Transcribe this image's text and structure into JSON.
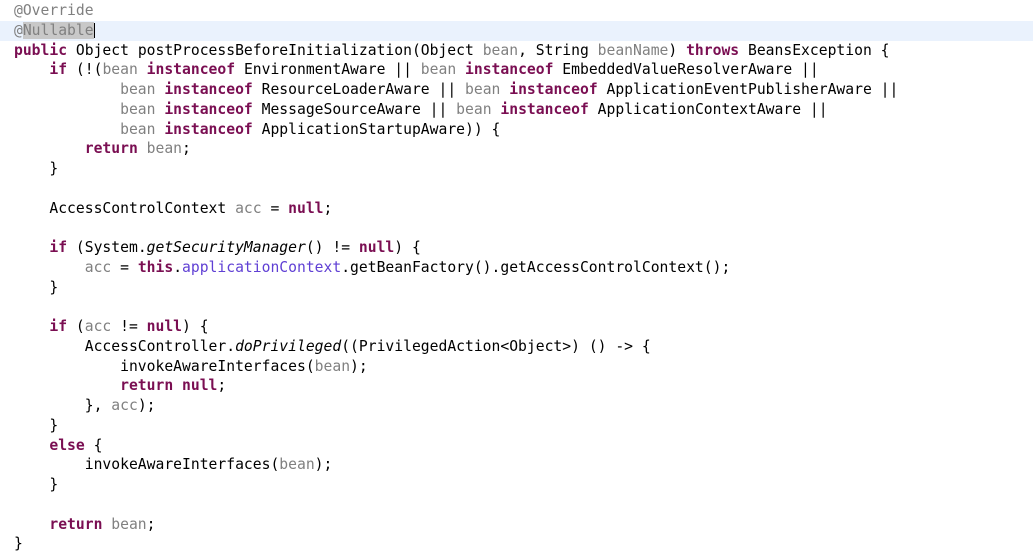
{
  "editor": {
    "language": "java",
    "background_color": "#ffffff",
    "current_line_highlight_color": "#eaf2fd",
    "selection_color": "#c8c8c8",
    "keyword_color": "#7a0e52",
    "annotation_color": "#808080",
    "parameter_color": "#808080",
    "field_color": "#5f3fd4",
    "text_color": "#000000",
    "caret_line_number": 2,
    "selected_text": "Nullable"
  },
  "lines": [
    {
      "n": 1,
      "text": "@Override"
    },
    {
      "n": 2,
      "text": "@Nullable"
    },
    {
      "n": 3,
      "text": "public Object postProcessBeforeInitialization(Object bean, String beanName) throws BeansException {"
    },
    {
      "n": 4,
      "text": "    if (!(bean instanceof EnvironmentAware || bean instanceof EmbeddedValueResolverAware ||"
    },
    {
      "n": 5,
      "text": "            bean instanceof ResourceLoaderAware || bean instanceof ApplicationEventPublisherAware ||"
    },
    {
      "n": 6,
      "text": "            bean instanceof MessageSourceAware || bean instanceof ApplicationContextAware ||"
    },
    {
      "n": 7,
      "text": "            bean instanceof ApplicationStartupAware)) {"
    },
    {
      "n": 8,
      "text": "        return bean;"
    },
    {
      "n": 9,
      "text": "    }"
    },
    {
      "n": 10,
      "text": ""
    },
    {
      "n": 11,
      "text": "    AccessControlContext acc = null;"
    },
    {
      "n": 12,
      "text": ""
    },
    {
      "n": 13,
      "text": "    if (System.getSecurityManager() != null) {"
    },
    {
      "n": 14,
      "text": "        acc = this.applicationContext.getBeanFactory().getAccessControlContext();"
    },
    {
      "n": 15,
      "text": "    }"
    },
    {
      "n": 16,
      "text": ""
    },
    {
      "n": 17,
      "text": "    if (acc != null) {"
    },
    {
      "n": 18,
      "text": "        AccessController.doPrivileged((PrivilegedAction<Object>) () -> {"
    },
    {
      "n": 19,
      "text": "            invokeAwareInterfaces(bean);"
    },
    {
      "n": 20,
      "text": "            return null;"
    },
    {
      "n": 21,
      "text": "        }, acc);"
    },
    {
      "n": 22,
      "text": "    }"
    },
    {
      "n": 23,
      "text": "    else {"
    },
    {
      "n": 24,
      "text": "        invokeAwareInterfaces(bean);"
    },
    {
      "n": 25,
      "text": "    }"
    },
    {
      "n": 26,
      "text": ""
    },
    {
      "n": 27,
      "text": "    return bean;"
    },
    {
      "n": 28,
      "text": "}"
    }
  ],
  "tokens": {
    "l1": {
      "annotation": "@Override"
    },
    "l2": {
      "at": "@",
      "selected": "Nullable"
    },
    "l3": {
      "kw_public": "public",
      "type_object": "Object",
      "method_name": "postProcessBeforeInitialization",
      "p1_type": "Object",
      "p1_name": "bean",
      "p2_type": "String",
      "p2_name": "beanName",
      "kw_throws": "throws",
      "exception": "BeansException"
    },
    "l4": {
      "kw_if": "if",
      "var_bean": "bean",
      "kw_instanceof": "instanceof",
      "type_a": "EnvironmentAware",
      "type_b": "EmbeddedValueResolverAware"
    },
    "l5": {
      "type_a": "ResourceLoaderAware",
      "type_b": "ApplicationEventPublisherAware"
    },
    "l6": {
      "type_a": "MessageSourceAware",
      "type_b": "ApplicationContextAware"
    },
    "l7": {
      "type_a": "ApplicationStartupAware"
    },
    "l8": {
      "kw_return": "return",
      "var_bean": "bean"
    },
    "l11": {
      "type": "AccessControlContext",
      "var": "acc",
      "kw_null": "null"
    },
    "l13": {
      "kw_if": "if",
      "type_system": "System",
      "static_method": "getSecurityManager",
      "kw_null": "null"
    },
    "l14": {
      "var_acc": "acc",
      "kw_this": "this",
      "field": "applicationContext",
      "m1": "getBeanFactory",
      "m2": "getAccessControlContext"
    },
    "l17": {
      "kw_if": "if",
      "var_acc": "acc",
      "kw_null": "null"
    },
    "l18": {
      "type": "AccessController",
      "static_method": "doPrivileged",
      "cast": "PrivilegedAction<Object>",
      "arrow": "() -> {"
    },
    "l19": {
      "method": "invokeAwareInterfaces",
      "var_bean": "bean"
    },
    "l20": {
      "kw_return": "return",
      "kw_null": "null"
    },
    "l21": {
      "var_acc": "acc"
    },
    "l23": {
      "kw_else": "else"
    },
    "l24": {
      "method": "invokeAwareInterfaces",
      "var_bean": "bean"
    },
    "l27": {
      "kw_return": "return",
      "var_bean": "bean"
    }
  }
}
